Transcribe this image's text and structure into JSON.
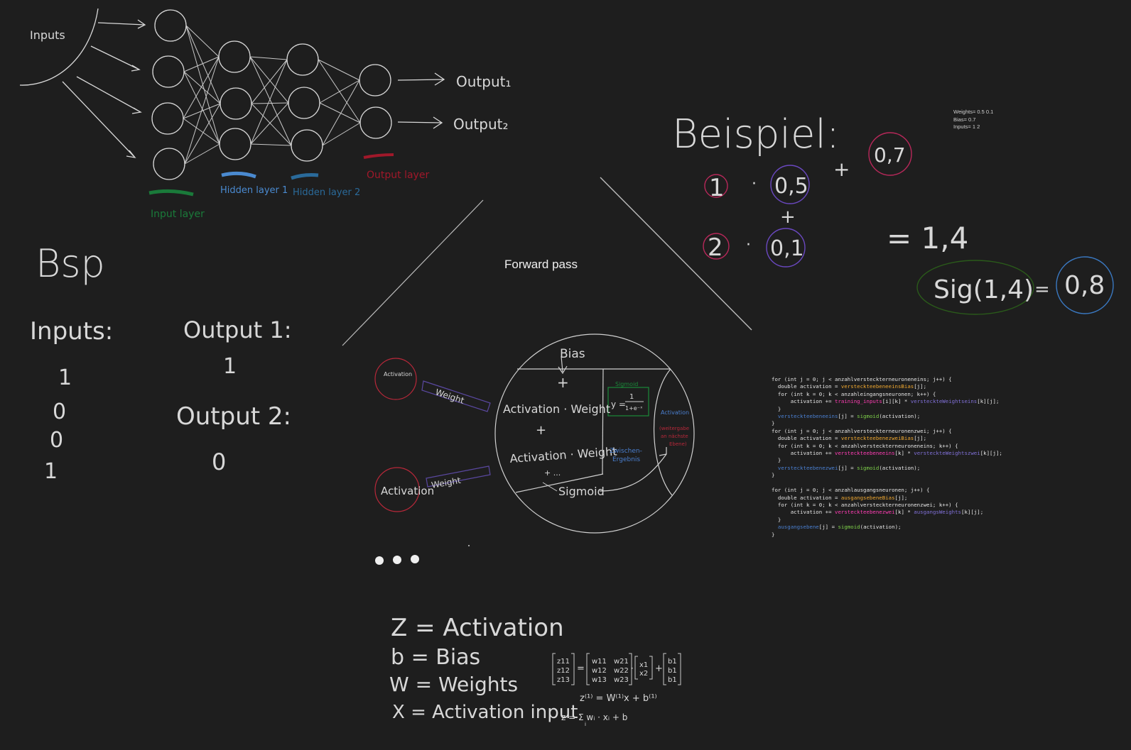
{
  "network": {
    "inputs_label": "Inputs",
    "output1_label": "Output₁",
    "output2_label": "Output₂",
    "input_layer": "Input layer",
    "hidden_layer1": "Hidden layer 1",
    "hidden_layer2": "Hidden layer 2",
    "output_layer": "Output layer",
    "colors": {
      "input": "#1a7a3a",
      "hidden1": "#4a8ad0",
      "hidden2": "#2a6a9a",
      "output": "#a0182a"
    }
  },
  "bsp": {
    "title": "Bsp",
    "inputs_heading": "Inputs:",
    "inputs": [
      "1",
      "0",
      "0",
      "1"
    ],
    "output1_heading": "Output 1:",
    "output1_value": "1",
    "output2_heading": "Output 2:",
    "output2_value": "0"
  },
  "forward_pass": {
    "title": "Forward pass",
    "bias": "Bias",
    "activation_small": "Activation",
    "activation_large": "Activation",
    "weight1": "Weight",
    "weight2": "Weight",
    "line1": "Activation · Weight",
    "plus": "+",
    "line2": "Activation · Weight",
    "dots": "+ ...",
    "sigmoid": "Sigmoid",
    "sigmoid_box_label": "Sigmoid",
    "sigmoid_formula_lhs": "y =",
    "sigmoid_formula_num": "1",
    "sigmoid_formula_den": "1+e⁻ˣ",
    "zwischen": "Zwischen-",
    "ergebnis": "Ergebnis",
    "activation_right": "Activation",
    "weitergabe1": "(weitergabe",
    "weitergabe2": "an nächste",
    "weitergabe3": "Ebene)"
  },
  "beispiel": {
    "title": "Beispiel:",
    "a1": "1",
    "w1": "0,5",
    "a2": "2",
    "w2": "0,1",
    "bias": "0,7",
    "sum": "= 1,4",
    "sig": "Sig(1,4)",
    "result": "0,8",
    "dot": "·",
    "plus": "+",
    "eq": "="
  },
  "note": {
    "weights": "Weights= 0.5 0.1",
    "bias": "Bias= 0.7",
    "inputs": "Inputs= 1 2"
  },
  "legend": {
    "z": "Z = Activation",
    "b": "b = Bias",
    "w": "W = Weights",
    "x": "X = Activation input",
    "eq1": "z⁽¹⁾ = W⁽¹⁾x + b⁽¹⁾",
    "eq2": "z = Σ wᵢ · xᵢ + b",
    "eq2_sub": "i",
    "matrix_z": [
      "z11",
      "z12",
      "z13"
    ],
    "matrix_w": [
      [
        "w11",
        "w21"
      ],
      [
        "w12",
        "w22"
      ],
      [
        "w13",
        "w23"
      ]
    ],
    "matrix_x": [
      "x1",
      "x2"
    ],
    "matrix_b": [
      "b1",
      "b1",
      "b1"
    ]
  },
  "code": {
    "lines": [
      [
        [
          "for (int j = 0; j < anzahlversteckterneuroneneins; j++) {",
          ""
        ]
      ],
      [
        [
          "  double activation = ",
          ""
        ],
        [
          "versteckteebeneeinsBias",
          "or"
        ],
        [
          "[j];",
          ""
        ]
      ],
      [
        [
          "  for (int k = 0; k < anzahleingangsneuronen; k++) {",
          ""
        ]
      ],
      [
        [
          "      activation += ",
          ""
        ],
        [
          "training_inputs",
          "pk"
        ],
        [
          "[i][k] * ",
          ""
        ],
        [
          "versteckteWeightseins",
          "pu"
        ],
        [
          "[k][j];",
          ""
        ]
      ],
      [
        [
          "  }",
          ""
        ]
      ],
      [
        [
          "  ",
          ""
        ],
        [
          "versteckteebeneeins",
          "bl"
        ],
        [
          "[j] = ",
          ""
        ],
        [
          "sigmoid",
          "gr"
        ],
        [
          "(activation);",
          ""
        ]
      ],
      [
        [
          "}",
          ""
        ]
      ],
      [
        [
          "for (int j = 0; j < anzahlversteckterneuronenzwei; j++) {",
          ""
        ]
      ],
      [
        [
          "  double activation = ",
          ""
        ],
        [
          "versteckteebenezweiBias",
          "or"
        ],
        [
          "[j];",
          ""
        ]
      ],
      [
        [
          "  for (int k = 0; k < anzahlversteckterneuroneneins; k++) {",
          ""
        ]
      ],
      [
        [
          "      activation += ",
          ""
        ],
        [
          "versteckteebeneeins",
          "pk"
        ],
        [
          "[k] * ",
          ""
        ],
        [
          "versteckteWeightszwei",
          "pu"
        ],
        [
          "[k][j];",
          ""
        ]
      ],
      [
        [
          "  }",
          ""
        ]
      ],
      [
        [
          "  ",
          ""
        ],
        [
          "versteckteebenezwei",
          "bl"
        ],
        [
          "[j] = ",
          ""
        ],
        [
          "sigmoid",
          "gr"
        ],
        [
          "(activation);",
          ""
        ]
      ],
      [
        [
          "}",
          ""
        ]
      ],
      [
        [
          "",
          ""
        ]
      ],
      [
        [
          "for (int j = 0; j < anzahlausgangsneuronen; j++) {",
          ""
        ]
      ],
      [
        [
          "  double activation = ",
          ""
        ],
        [
          "ausgangsebeneBias",
          "or"
        ],
        [
          "[j];",
          ""
        ]
      ],
      [
        [
          "  for (int k = 0; k < anzahlversteckterneuronenzwei; k++) {",
          ""
        ]
      ],
      [
        [
          "      activation += ",
          ""
        ],
        [
          "versteckteebenezwei",
          "pk"
        ],
        [
          "[k] * ",
          ""
        ],
        [
          "ausgangsWeights",
          "pu"
        ],
        [
          "[k][j];",
          ""
        ]
      ],
      [
        [
          "  }",
          ""
        ]
      ],
      [
        [
          "  ",
          ""
        ],
        [
          "ausgangsebene",
          "bl"
        ],
        [
          "[j] = ",
          ""
        ],
        [
          "sigmoid",
          "gr"
        ],
        [
          "(activation);",
          ""
        ]
      ],
      [
        [
          "}",
          ""
        ]
      ]
    ]
  },
  "pager": {
    "dots": 3
  }
}
